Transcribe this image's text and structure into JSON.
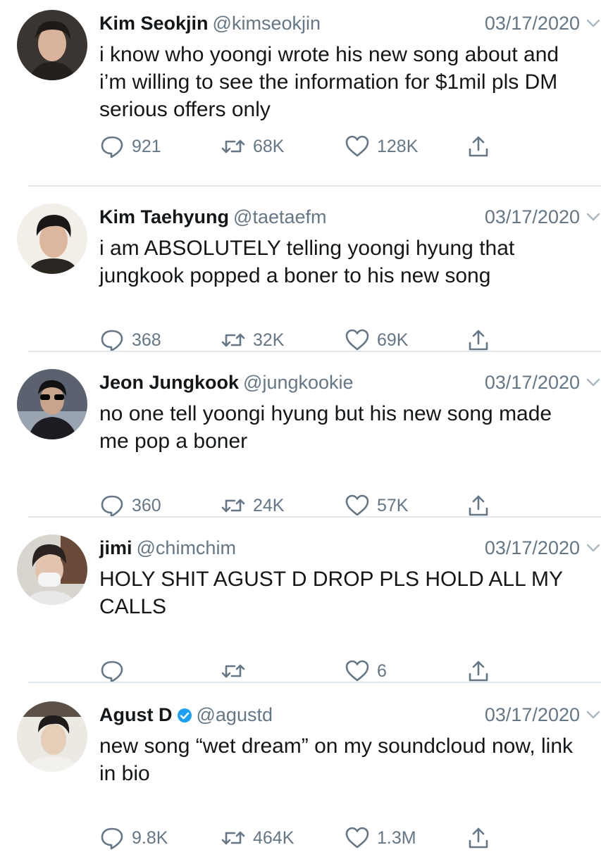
{
  "tweets": [
    {
      "name": "Kim Seokjin",
      "handle": "@kimseokjin",
      "verified": false,
      "date": "03/17/2020",
      "text": "i know who yoongi wrote his new song about and i’m willing to see the information for $1mil pls DM serious offers only",
      "replies": "921",
      "retweets": "68K",
      "likes": "128K"
    },
    {
      "name": "Kim Taehyung",
      "handle": "@taetaefm",
      "verified": false,
      "date": "03/17/2020",
      "text": "i am ABSOLUTELY telling yoongi hyung that jungkook popped a boner to his new song",
      "replies": "368",
      "retweets": "32K",
      "likes": "69K"
    },
    {
      "name": "Jeon Jungkook",
      "handle": "@jungkookie",
      "verified": false,
      "date": "03/17/2020",
      "text": "no one tell yoongi hyung but his new song made me pop a boner",
      "replies": "360",
      "retweets": "24K",
      "likes": "57K"
    },
    {
      "name": "jimi",
      "handle": "@chimchim",
      "verified": false,
      "date": "03/17/2020",
      "text": "HOLY SHIT AGUST D DROP PLS HOLD ALL MY CALLS",
      "replies": "",
      "retweets": "",
      "likes": "6"
    },
    {
      "name": "Agust D",
      "handle": "@agustd",
      "verified": true,
      "date": "03/17/2020",
      "text": "new song “wet dream” on my soundcloud now, link in bio",
      "replies": "9.8K",
      "retweets": "464K",
      "likes": "1.3M"
    }
  ],
  "colors": {
    "text": "#14171a",
    "secondary": "#657786",
    "divider": "#e1e8ed",
    "verified": "#1da1f2"
  },
  "icons": {
    "reply": "reply-icon",
    "retweet": "retweet-icon",
    "like": "heart-icon",
    "share": "share-icon",
    "more": "chevron-down-icon",
    "verified": "verified-badge-icon"
  }
}
